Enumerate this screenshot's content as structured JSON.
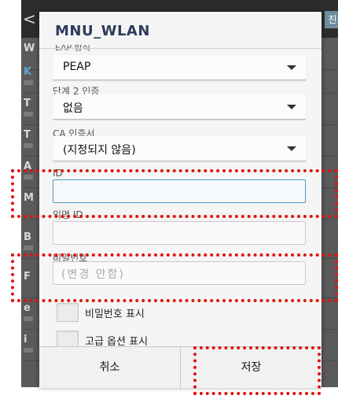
{
  "dialog": {
    "title": "MNU_WLAN",
    "eap_method_label": "EAP 방식",
    "eap_method_value": "PEAP",
    "phase2_label": "단계 2 인증",
    "phase2_value": "없음",
    "ca_cert_label": "CA 인증서",
    "ca_cert_value": "(지정되지 않음)",
    "identity_label": "ID",
    "identity_value": "",
    "anonymous_label": "익명 ID",
    "anonymous_value": "",
    "password_label": "비밀번호",
    "password_placeholder": "(변경 안함)",
    "show_password_label": "비밀번호 표시",
    "show_advanced_label": "고급 옵션 표시",
    "cancel_label": "취소",
    "save_label": "저장"
  },
  "background": {
    "back_glyph": "<",
    "right_button_text": "진",
    "row_letters": [
      "W",
      "K",
      "T",
      "T",
      "A",
      "M",
      "B",
      "F",
      "e",
      "i"
    ]
  },
  "colors": {
    "annotation": "#e2120f",
    "title": "#2d3b5c",
    "focus_border": "#4f9ac7"
  }
}
